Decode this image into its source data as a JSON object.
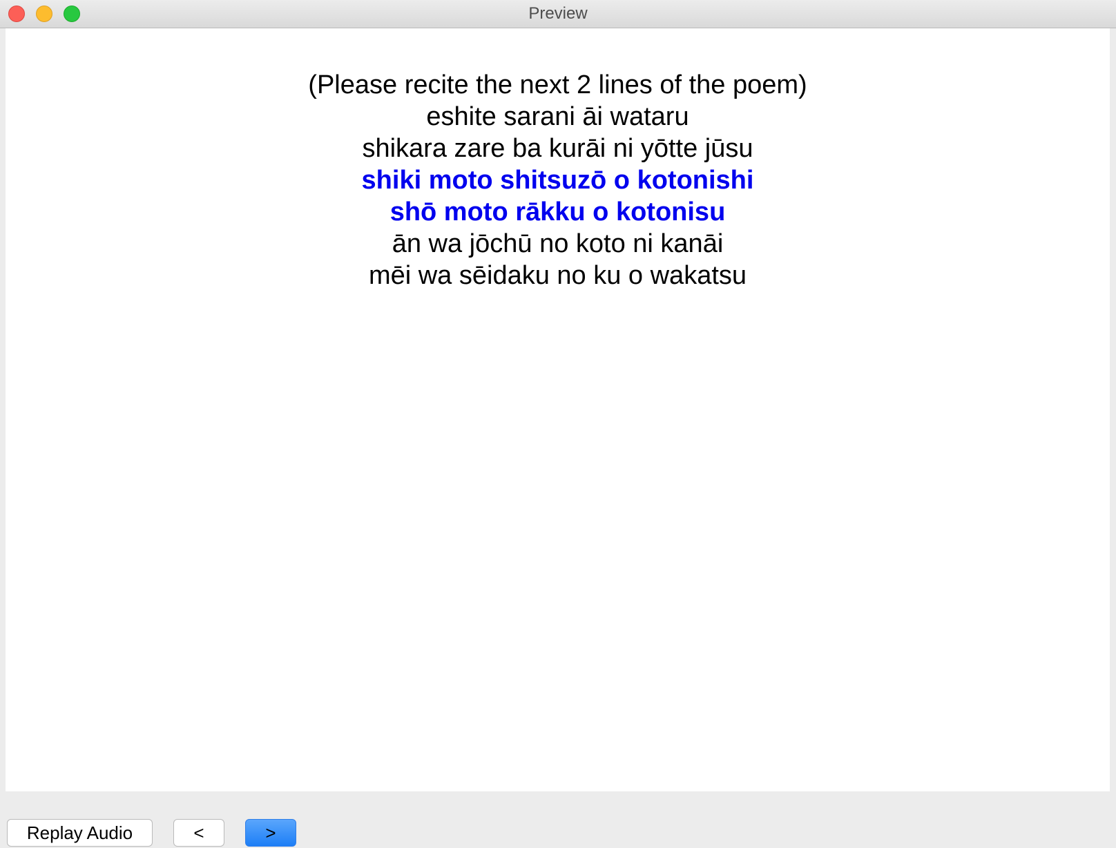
{
  "window": {
    "title": "Preview"
  },
  "poem": {
    "lines": [
      {
        "text": "(Please recite the next 2 lines of the poem)",
        "highlight": false
      },
      {
        "text": "eshite sarani āi wataru",
        "highlight": false
      },
      {
        "text": "shikara zare ba kurāi ni yōtte jūsu",
        "highlight": false
      },
      {
        "text": "shiki moto shitsuzō o kotonishi",
        "highlight": true
      },
      {
        "text": "shō moto rākku o kotonisu",
        "highlight": true
      },
      {
        "text": "ān wa jōchū no koto ni kanāi",
        "highlight": false
      },
      {
        "text": "mēi wa sēidaku no ku o wakatsu",
        "highlight": false
      }
    ],
    "highlight_color": "#0000ee"
  },
  "toolbar": {
    "replay_label": "Replay Audio",
    "prev_label": "<",
    "next_label": ">"
  }
}
